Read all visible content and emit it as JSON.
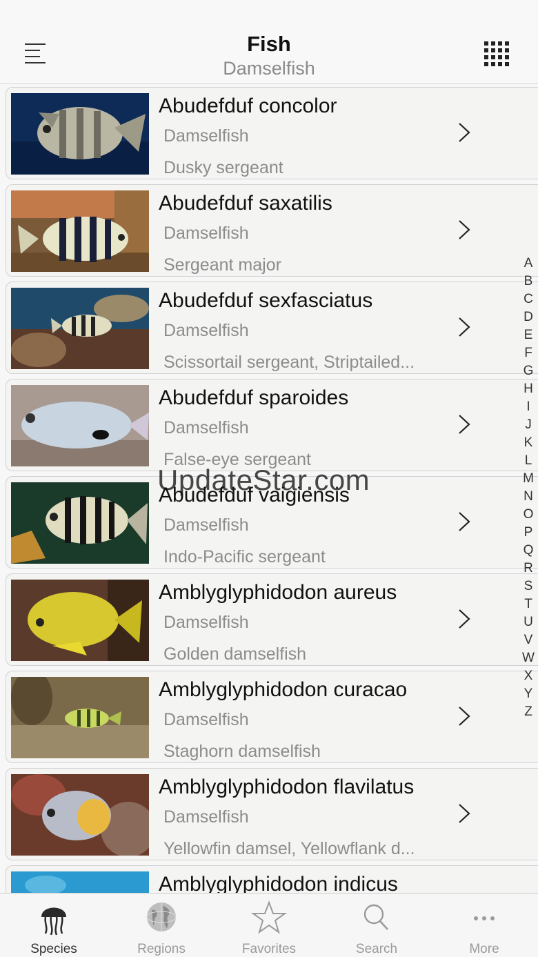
{
  "header": {
    "title": "Fish",
    "subtitle": "Damselfish",
    "menu_icon": "menu-icon",
    "grid_icon": "grid-view-icon"
  },
  "species": [
    {
      "scientific": "Abudefduf concolor",
      "family": "Damselfish",
      "common": "Dusky sergeant"
    },
    {
      "scientific": "Abudefduf saxatilis",
      "family": "Damselfish",
      "common": "Sergeant major"
    },
    {
      "scientific": "Abudefduf sexfasciatus",
      "family": "Damselfish",
      "common": "Scissortail sergeant, Striptailed..."
    },
    {
      "scientific": "Abudefduf sparoides",
      "family": "Damselfish",
      "common": "False-eye sergeant"
    },
    {
      "scientific": "Abudefduf vaigiensis",
      "family": "Damselfish",
      "common": "Indo-Pacific sergeant"
    },
    {
      "scientific": "Amblyglyphidodon aureus",
      "family": "Damselfish",
      "common": "Golden damselfish"
    },
    {
      "scientific": "Amblyglyphidodon curacao",
      "family": "Damselfish",
      "common": "Staghorn damselfish"
    },
    {
      "scientific": "Amblyglyphidodon flavilatus",
      "family": "Damselfish",
      "common": "Yellowfin damsel, Yellowflank d..."
    },
    {
      "scientific": "Amblyglyphidodon indicus",
      "family": "",
      "common": ""
    }
  ],
  "alphabet": [
    "A",
    "B",
    "C",
    "D",
    "E",
    "F",
    "G",
    "H",
    "I",
    "J",
    "K",
    "L",
    "M",
    "N",
    "O",
    "P",
    "Q",
    "R",
    "S",
    "T",
    "U",
    "V",
    "W",
    "X",
    "Y",
    "Z"
  ],
  "watermark": "UpdateStar.com",
  "tabs": [
    {
      "label": "Species",
      "icon": "jellyfish-icon",
      "active": true
    },
    {
      "label": "Regions",
      "icon": "globe-icon",
      "active": false
    },
    {
      "label": "Favorites",
      "icon": "star-icon",
      "active": false
    },
    {
      "label": "Search",
      "icon": "search-icon",
      "active": false
    },
    {
      "label": "More",
      "icon": "more-icon",
      "active": false
    }
  ],
  "colors": {
    "text_primary": "#111111",
    "text_secondary": "#8c8c8c",
    "tab_inactive": "#9a9a9a",
    "tab_active": "#333333"
  }
}
